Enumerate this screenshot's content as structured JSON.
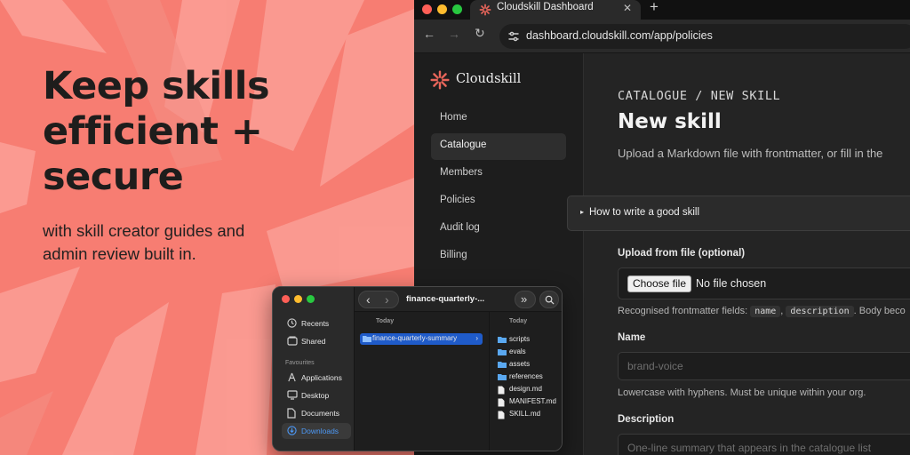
{
  "promo": {
    "headline_line1": "Keep skills",
    "headline_line2": "efficient +",
    "headline_line3": "secure",
    "subline_line1": "with skill creator guides and",
    "subline_line2": "admin review built in."
  },
  "browser": {
    "tab_title": "Cloudskill Dashboard",
    "close_glyph": "✕",
    "new_tab_glyph": "+",
    "back_glyph": "←",
    "forward_glyph": "→",
    "reload_glyph": "↻",
    "url": "dashboard.cloudskill.com/app/policies"
  },
  "app": {
    "brand": "Cloudskill",
    "brand_color": "#e8655a",
    "nav": [
      {
        "label": "Home",
        "active": false
      },
      {
        "label": "Catalogue",
        "active": true
      },
      {
        "label": "Members",
        "active": false
      },
      {
        "label": "Policies",
        "active": false
      },
      {
        "label": "Audit log",
        "active": false
      },
      {
        "label": "Billing",
        "active": false
      }
    ],
    "breadcrumb": "CATALOGUE / NEW SKILL",
    "title": "New skill",
    "description": "Upload a Markdown file with frontmatter, or fill in the",
    "disclosure": {
      "arrow": "▸",
      "label": "How to write a good skill"
    },
    "upload": {
      "label": "Upload from file (optional)",
      "button": "Choose file",
      "status": "No file chosen",
      "hint_prefix": "Recognised frontmatter fields:",
      "field_name": "name",
      "sep": ",",
      "field_description": "description",
      "hint_suffix": ". Body beco"
    },
    "name_field": {
      "label": "Name",
      "placeholder": "brand-voice",
      "hint": "Lowercase with hyphens. Must be unique within your org."
    },
    "description_field": {
      "label": "Description",
      "placeholder": "One-line summary that appears in the catalogue list"
    }
  },
  "finder": {
    "title": "finance-quarterly-...",
    "sidebar": [
      {
        "label": "Recents",
        "icon": "clock-icon"
      },
      {
        "label": "Shared",
        "icon": "shared-icon"
      }
    ],
    "favourites_heading": "Favourites",
    "favourites": [
      {
        "label": "Applications",
        "icon": "applications-icon"
      },
      {
        "label": "Desktop",
        "icon": "desktop-icon"
      },
      {
        "label": "Documents",
        "icon": "document-icon"
      },
      {
        "label": "Downloads",
        "icon": "download-icon",
        "selected": true
      }
    ],
    "col1_heading": "Today",
    "col1_items": [
      {
        "label": "finance-quarterly-summary",
        "type": "folder",
        "selected": true
      }
    ],
    "col2_heading": "Today",
    "col2_items": [
      {
        "label": "scripts",
        "type": "folder"
      },
      {
        "label": "evals",
        "type": "folder"
      },
      {
        "label": "assets",
        "type": "folder"
      },
      {
        "label": "references",
        "type": "folder"
      },
      {
        "label": "design.md",
        "type": "file"
      },
      {
        "label": "MANIFEST.md",
        "type": "file"
      },
      {
        "label": "SKILL.md",
        "type": "file"
      }
    ],
    "back_glyph": "‹",
    "forward_glyph": "›",
    "more_glyph": "»"
  },
  "colors": {
    "promo_bg": "#f77d72",
    "promo_rays": "#fb9f96",
    "accent_blue": "#4c98f5"
  }
}
